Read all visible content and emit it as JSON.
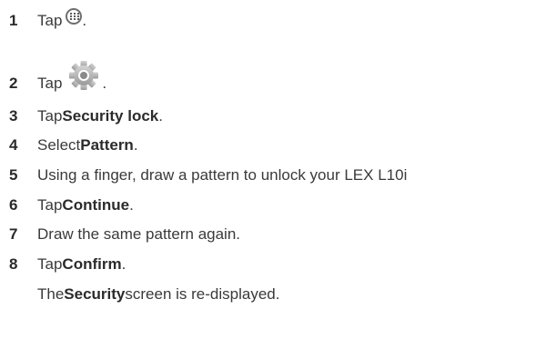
{
  "steps": [
    {
      "num": "1",
      "pre": "Tap ",
      "post": ".",
      "icon": "apps-icon"
    },
    {
      "num": "2",
      "pre": "Tap ",
      "post": ".",
      "icon": "settings-gear-icon"
    },
    {
      "num": "3",
      "pre": "Tap ",
      "bold": "Security lock",
      "post": "."
    },
    {
      "num": "4",
      "pre": "Select ",
      "bold": "Pattern",
      "post": "."
    },
    {
      "num": "5",
      "pre": "Using a finger, draw a pattern to unlock your LEX L10i"
    },
    {
      "num": "6",
      "pre": "Tap ",
      "bold": "Continue",
      "post": "."
    },
    {
      "num": "7",
      "pre": "Draw the same pattern again."
    },
    {
      "num": "8",
      "pre": "Tap ",
      "bold": "Confirm",
      "post": "."
    }
  ],
  "note": {
    "pre": "The ",
    "bold": "Security",
    "post": " screen is re-displayed."
  }
}
